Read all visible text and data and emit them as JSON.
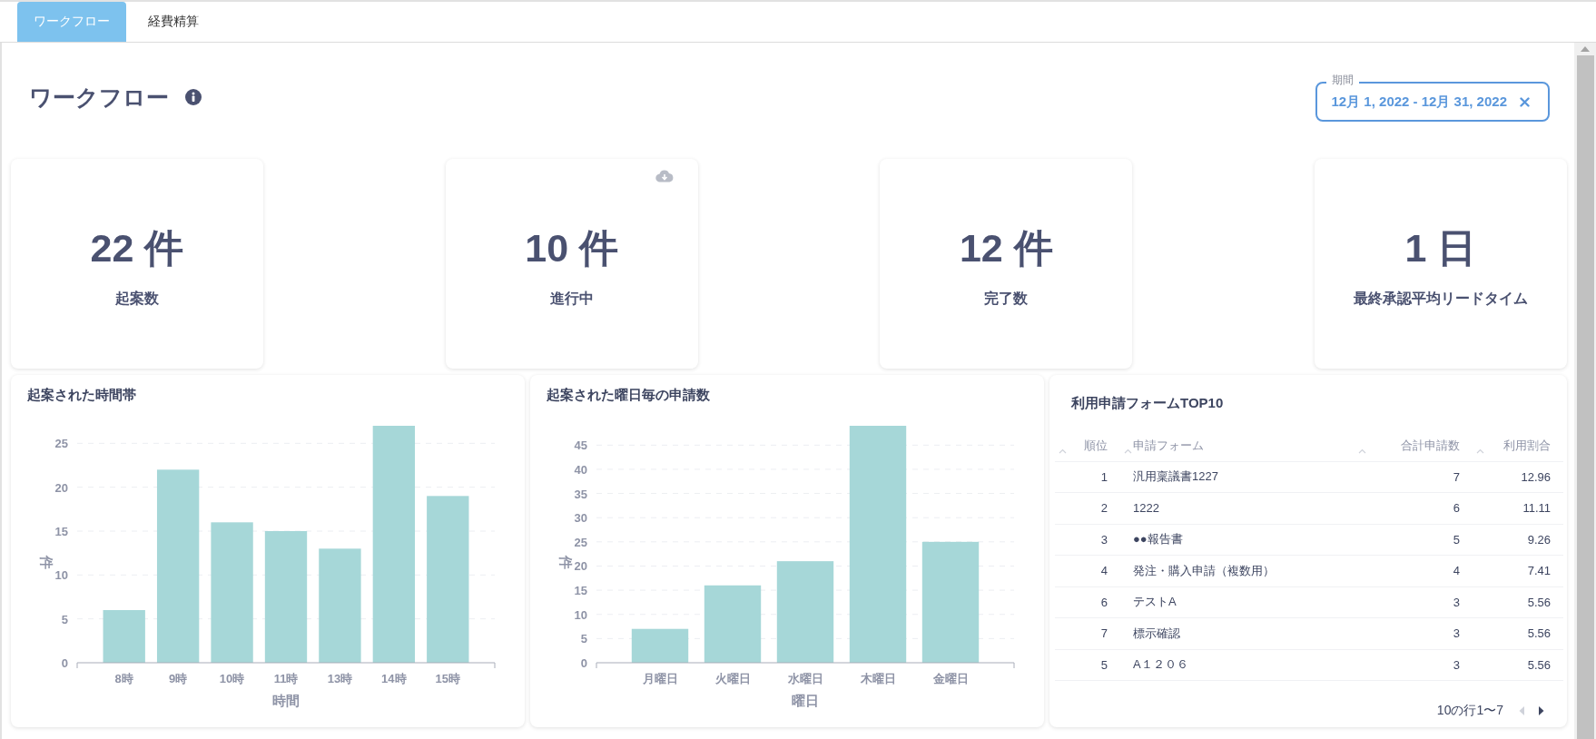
{
  "tabs": [
    {
      "label": "ワークフロー",
      "selected": true
    },
    {
      "label": "経費精算",
      "selected": false
    }
  ],
  "page_title": "ワークフロー",
  "period_filter": {
    "label": "期間",
    "value": "12月 1, 2022 - 12月 31, 2022"
  },
  "stats": [
    {
      "value": "22 件",
      "label": "起案数",
      "download": false
    },
    {
      "value": "10 件",
      "label": "進行中",
      "download": true
    },
    {
      "value": "12 件",
      "label": "完了数",
      "download": false
    },
    {
      "value": "1 日",
      "label": "最終承認平均リードタイム",
      "download": false
    }
  ],
  "charts": [
    {
      "chart_data": {
        "type": "bar",
        "title": "起案された時間帯",
        "xlabel": "時間",
        "ylabel": "件",
        "categories": [
          "8時",
          "9時",
          "10時",
          "11時",
          "13時",
          "14時",
          "15時"
        ],
        "series": [
          {
            "color": "#a6d7d8",
            "values": [
              6,
              22,
              16,
              15,
              13,
              27,
              19
            ]
          }
        ],
        "ylim": [
          0,
          27
        ],
        "grid": true,
        "yticks": [
          0,
          5,
          10,
          15,
          20,
          25
        ]
      }
    },
    {
      "chart_data": {
        "type": "bar",
        "title": "起案された曜日毎の申請数",
        "xlabel": "曜日",
        "ylabel": "件",
        "categories": [
          "月曜日",
          "火曜日",
          "水曜日",
          "木曜日",
          "金曜日"
        ],
        "series": [
          {
            "color": "#a6d7d8",
            "values": [
              7,
              16,
              21,
              49,
              25
            ]
          }
        ],
        "ylim": [
          0,
          49
        ],
        "grid": true,
        "yticks": [
          0,
          5,
          10,
          15,
          20,
          25,
          30,
          35,
          40,
          45
        ]
      }
    }
  ],
  "table": {
    "title": "利用申請フォームTOP10",
    "columns": [
      "順位",
      "申請フォーム",
      "合計申請数",
      "利用割合"
    ],
    "rows": [
      [
        "1",
        "汎用稟議書1227",
        "7",
        "12.96"
      ],
      [
        "2",
        "1222",
        "6",
        "11.11"
      ],
      [
        "3",
        "●●報告書",
        "5",
        "9.26"
      ],
      [
        "4",
        "発注・購入申請（複数用）",
        "4",
        "7.41"
      ],
      [
        "6",
        "テストA",
        "3",
        "5.56"
      ],
      [
        "7",
        "標示確認",
        "3",
        "5.56"
      ],
      [
        "5",
        "A１２０６",
        "3",
        "5.56"
      ]
    ],
    "pagination": {
      "text": "10の行1〜7",
      "prev_disabled": true,
      "next_disabled": false
    }
  }
}
